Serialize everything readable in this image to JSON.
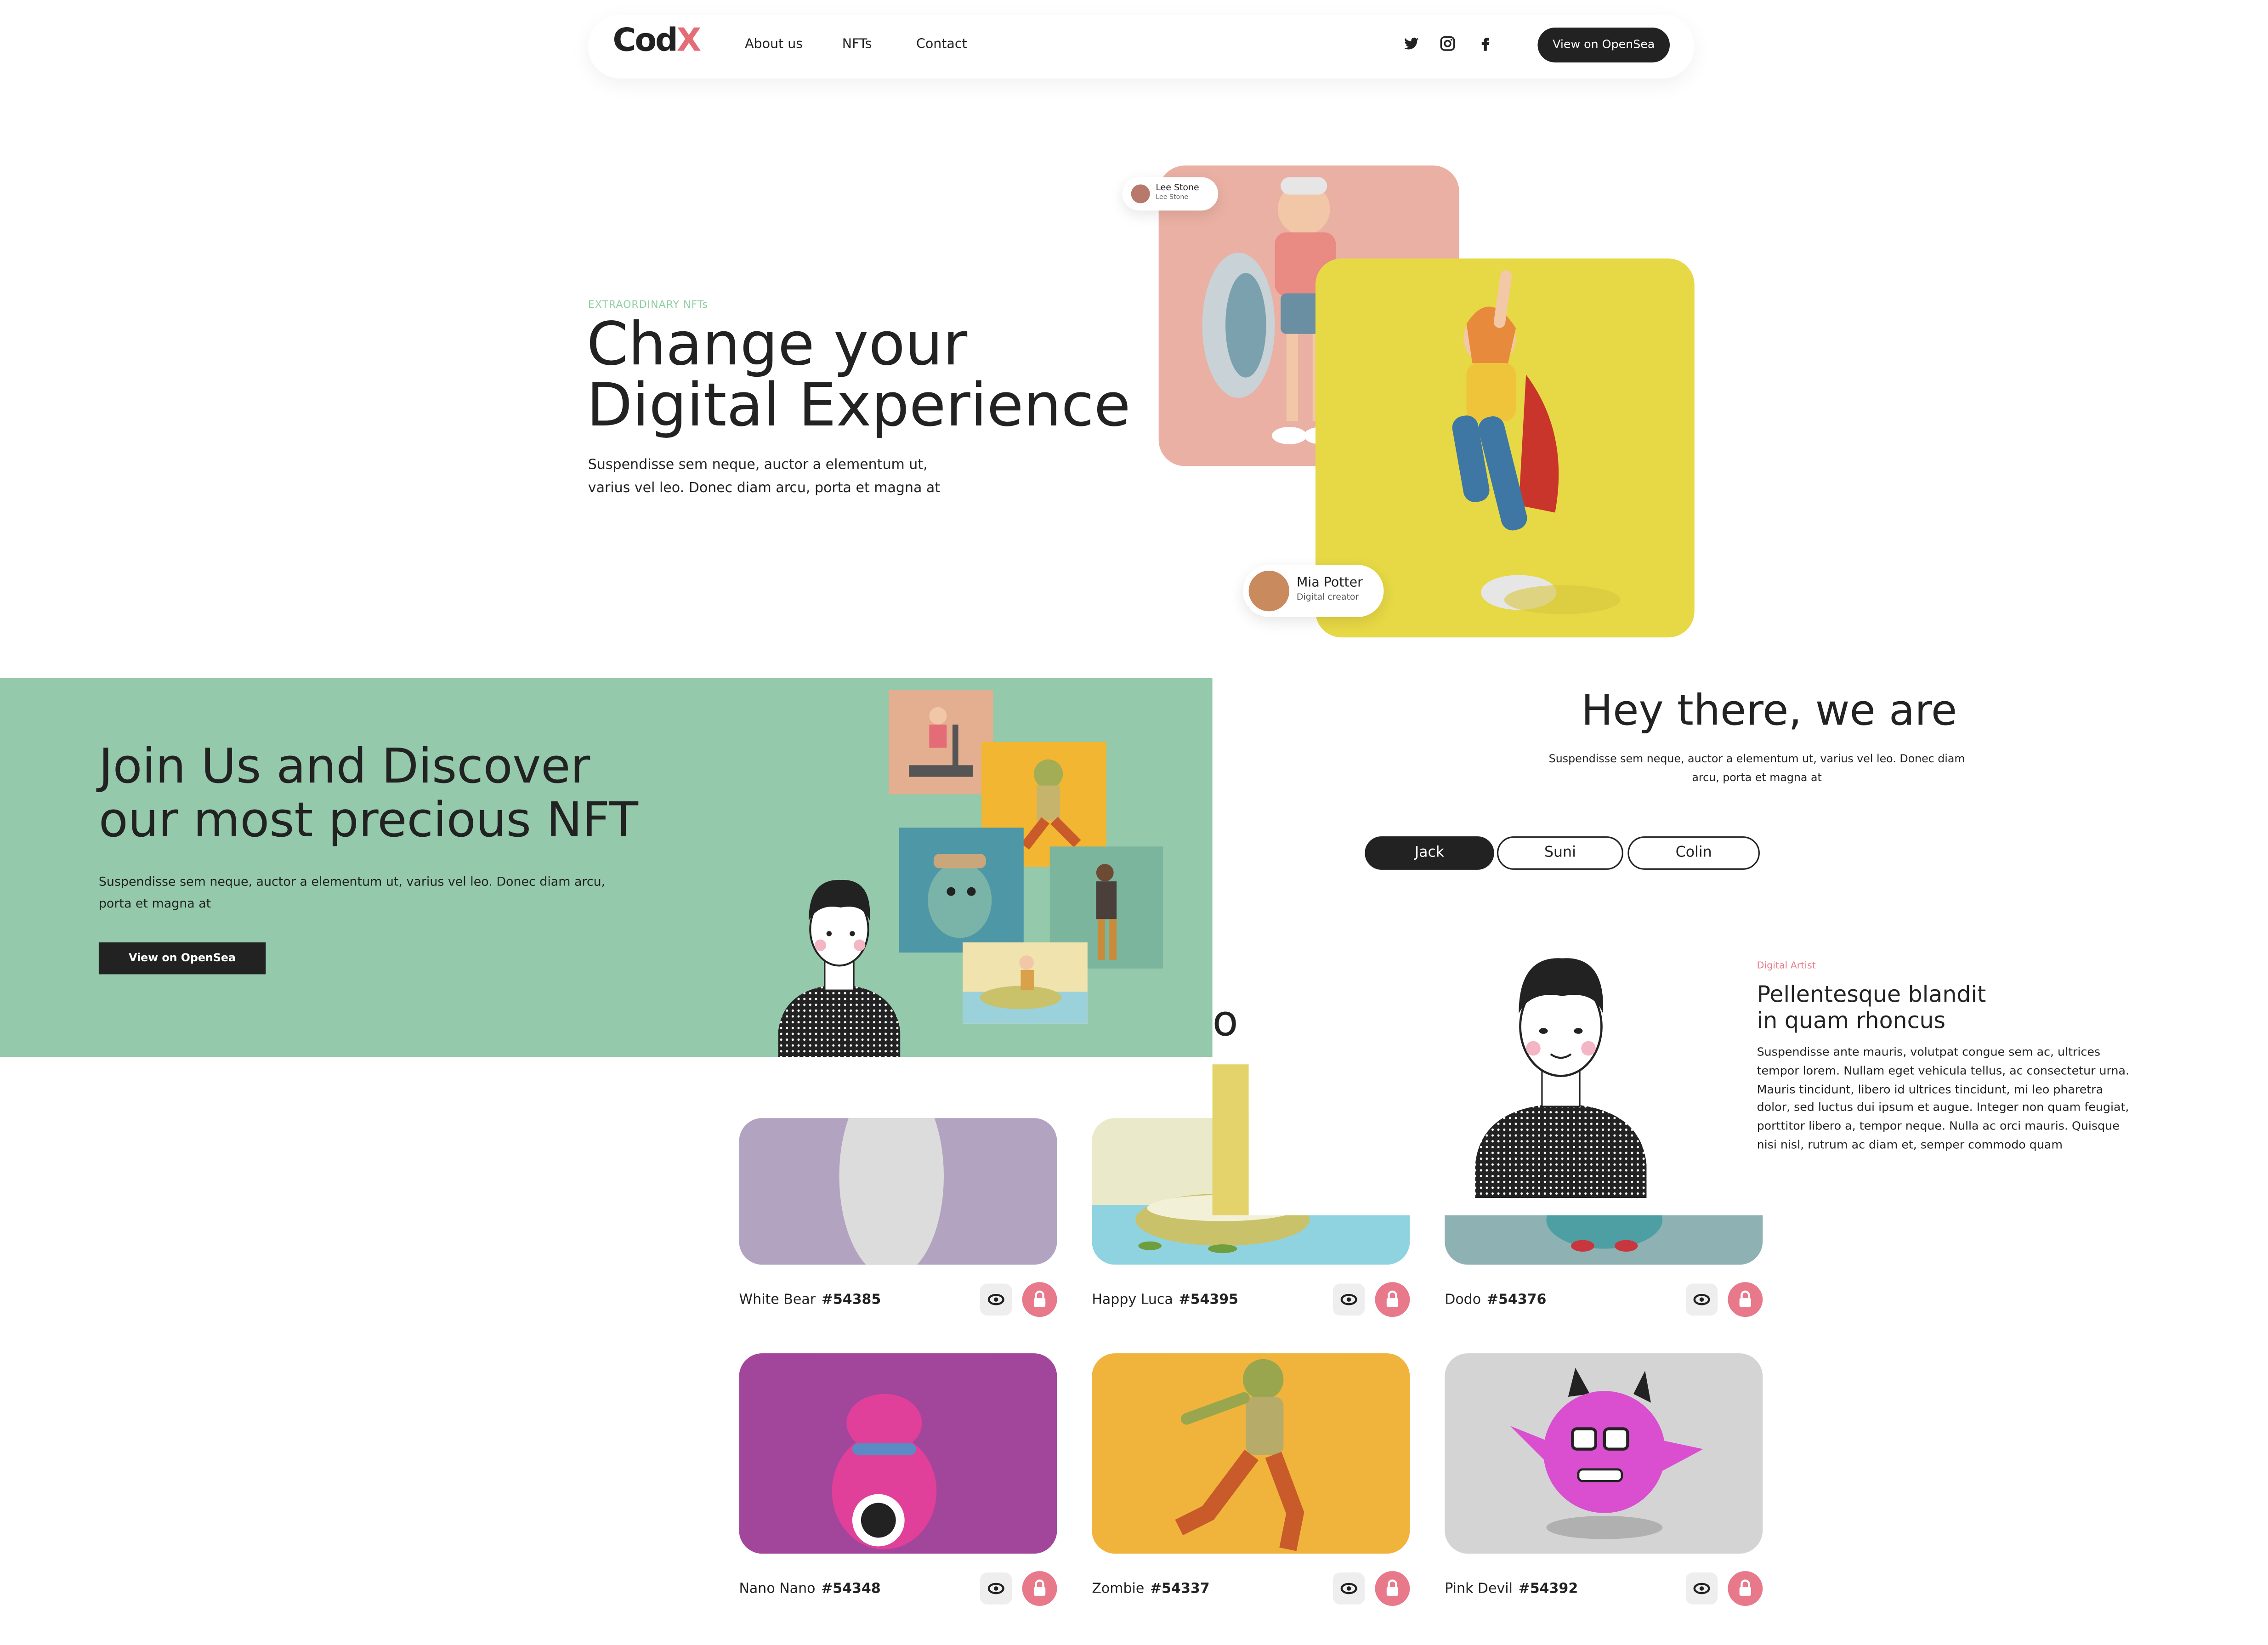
{
  "nav": {
    "logo_main": "Cod",
    "logo_accent": "X",
    "links": [
      "About us",
      "NFTs",
      "Contact"
    ],
    "cta": "View on OpenSea",
    "social_icons": [
      "twitter-icon",
      "instagram-icon",
      "facebook-icon"
    ]
  },
  "hero": {
    "eyebrow": "EXTRAORDINARY NFTs",
    "title_line1": "Change your",
    "title_line2": "Digital Experience",
    "desc_line1": "Suspendisse sem neque, auctor a elementum ut,",
    "desc_line2": "varius vel leo. Donec diam arcu, porta et magna at",
    "creator1": {
      "name": "Lee Stone",
      "role": "Lee Stone"
    },
    "creator2": {
      "name": "Mia Potter",
      "role": "Digital creator"
    }
  },
  "banner": {
    "title_line1": "Join Us and Discover",
    "title_line2": "our most precious NFT",
    "desc_line1": "Suspendisse sem neque, auctor a elementum ut, varius vel leo. Donec diam arcu,",
    "desc_line2": "porta et magna at",
    "cta": "View on OpenSea"
  },
  "team": {
    "title": "Hey there, we are",
    "desc_line1": "Suspendisse sem neque, auctor a elementum ut, varius vel leo. Donec diam",
    "desc_line2": "arcu, porta et magna at",
    "tabs": [
      "Jack",
      "Suni",
      "Colin"
    ],
    "active_tab": "Jack",
    "profile": {
      "role": "Digital Artist",
      "heading_line1": "Pellentesque blandit",
      "heading_line2": "in quam rhoncus",
      "bio": [
        "Suspendisse ante mauris, volutpat congue sem ac, ultrices",
        "tempor lorem. Nullam eget vehicula tellus, ac consectetur urna.",
        "Mauris tincidunt, libero id ultrices tincidunt, mi leo pharetra",
        "dolor, sed luctus dui ipsum et augue. Integer non quam feugiat,",
        "porttitor libero a, tempor neque. Nulla ac orci mauris. Quisque",
        "nisi nisl, rutrum ac diam et, semper commodo quam"
      ]
    }
  },
  "nfts": [
    {
      "name": "White Bear",
      "id": "#54385"
    },
    {
      "name": "Happy Luca",
      "id": "#54395"
    },
    {
      "name": "Dodo",
      "id": "#54376"
    },
    {
      "name": "Nano Nano",
      "id": "#54348"
    },
    {
      "name": "Zombie",
      "id": "#54337"
    },
    {
      "name": "Pink Devil",
      "id": "#54392"
    }
  ],
  "colors": {
    "accent_pink": "#e8798a",
    "accent_green": "#94c9ab",
    "dark": "#222222",
    "hero_pink_card": "#eab0a3",
    "hero_yellow_card": "#e7d845"
  }
}
